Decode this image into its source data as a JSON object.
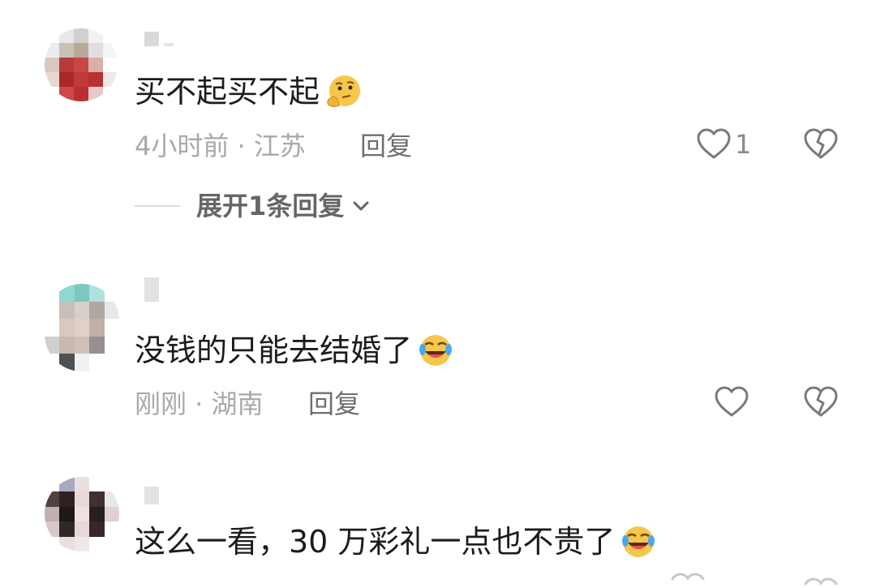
{
  "colors": {
    "text_primary": "#1c1c1c",
    "text_meta": "#a9a9a9",
    "text_reply": "#6e6e6e",
    "icon": "#7a7a7a"
  },
  "comments": [
    {
      "text": "买不起买不起",
      "emoji": "thinking-face-emoji",
      "time": "4小时前",
      "location": "江苏",
      "meta": "4小时前 · 江苏",
      "reply_label": "回复",
      "like_count": "1",
      "expand_label": "展开1条回复"
    },
    {
      "text": "没钱的只能去结婚了",
      "emoji": "rolling-on-floor-laughing-emoji",
      "time": "刚刚",
      "location": "湖南",
      "meta": "刚刚 · 湖南",
      "reply_label": "回复"
    },
    {
      "text": "这么一看，30 万彩礼一点也不贵了",
      "emoji": "rolling-on-floor-laughing-emoji"
    }
  ],
  "icons": {
    "like": "heart-outline-icon",
    "dislike": "broken-heart-icon",
    "expand": "chevron-down-icon"
  }
}
